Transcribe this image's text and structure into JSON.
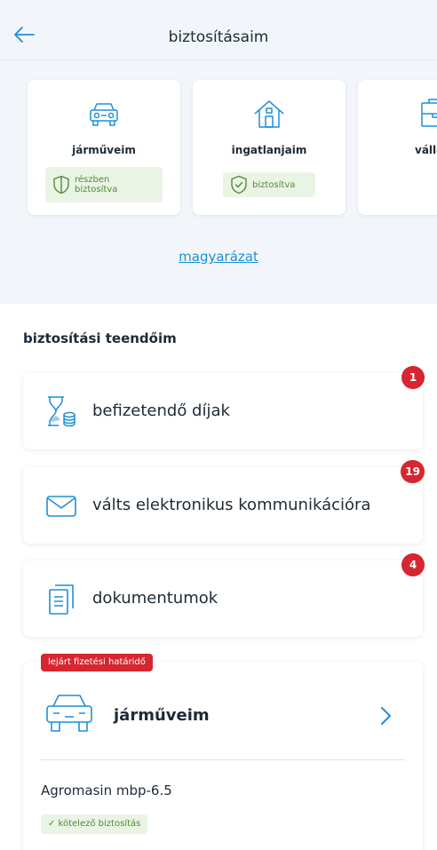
{
  "header": {
    "title": "biztosításaim",
    "back_icon": "arrow-left-icon"
  },
  "categories": [
    {
      "label": "járműveim",
      "icon": "car-icon",
      "status": "részben\nbiztosítva",
      "status_icon": "shield-half-icon"
    },
    {
      "label": "ingatlanjaim",
      "icon": "house-icon",
      "status": "biztosítva",
      "status_icon": "shield-check-icon"
    },
    {
      "label": "vállalko",
      "icon": "business-icon"
    }
  ],
  "explain_link": "magyarázat",
  "todos": {
    "title": "biztosítási teendőim",
    "items": [
      {
        "label": "befizetendő díjak",
        "icon": "hourglass-coins-icon",
        "count": "1"
      },
      {
        "label": "válts elektronikus kommunikációra",
        "icon": "envelope-icon",
        "count": "19"
      },
      {
        "label": "dokumentumok",
        "icon": "document-icon",
        "count": "4"
      }
    ]
  },
  "vehicle": {
    "warning": "lejárt fizetési határidő",
    "title": "járműveim",
    "name": "Agromasin mbp-6.5",
    "tag": "✓ kötelező biztosítás"
  },
  "colors": {
    "accent": "#1f8fd8",
    "alert": "#d6262f",
    "success_bg": "#eaf4e4",
    "success_text": "#4f8a3a",
    "band_bg": "#f2f6fa"
  }
}
